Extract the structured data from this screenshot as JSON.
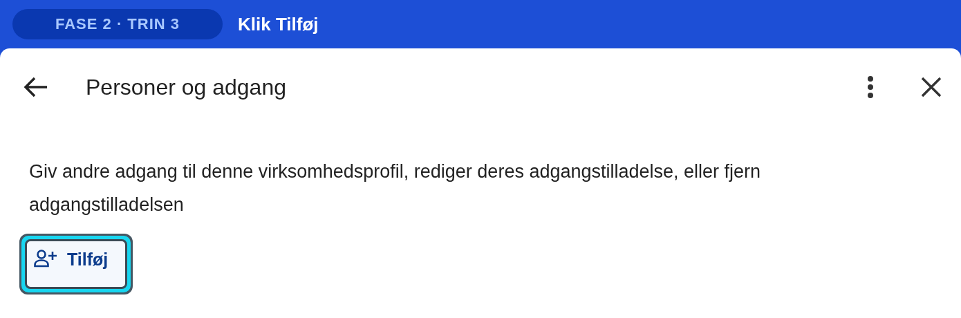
{
  "guide_bar": {
    "step_badge": "FASE 2 · TRIN 3",
    "instruction": "Klik Tilføj"
  },
  "panel": {
    "title": "Personer og adgang",
    "description": "Giv andre adgang til denne virksomhedsprofil, rediger deres adgangstilladelse, eller fjern adgangstilladelsen",
    "add_button": {
      "label": "Tilføj",
      "highlighted": true
    }
  }
}
